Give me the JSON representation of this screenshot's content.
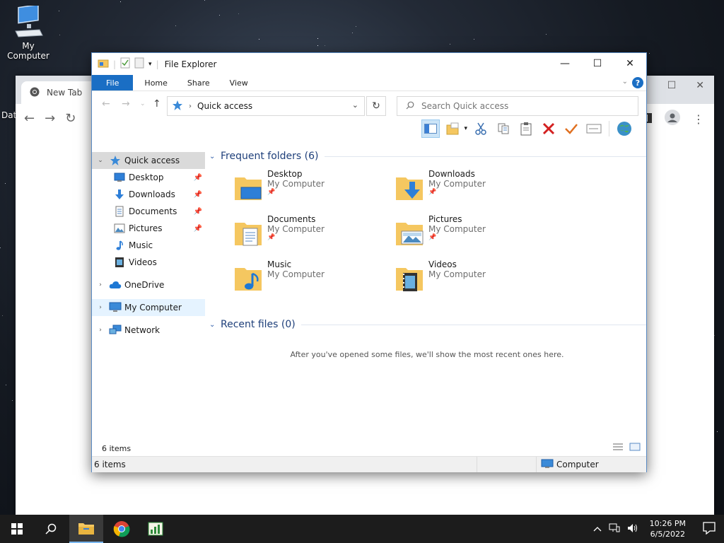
{
  "desktop": {
    "icon_label": "My Computer",
    "partial_label": "Dat"
  },
  "chrome": {
    "tab_title": "New Tab"
  },
  "explorer": {
    "title": "File Explorer",
    "ribbon_tabs": [
      "File",
      "Home",
      "Share",
      "View"
    ],
    "help_label": "?",
    "address": "Quick access",
    "search_placeholder": "Search Quick access",
    "nav": {
      "quick_access": "Quick access",
      "desktop": "Desktop",
      "downloads": "Downloads",
      "documents": "Documents",
      "pictures": "Pictures",
      "music": "Music",
      "videos": "Videos",
      "onedrive": "OneDrive",
      "my_computer": "My Computer",
      "network": "Network"
    },
    "frequent_header": "Frequent folders (6)",
    "folders": [
      {
        "name": "Desktop",
        "location": "My Computer",
        "pinned": true,
        "icon": "folder-desktop-icon"
      },
      {
        "name": "Downloads",
        "location": "My Computer",
        "pinned": true,
        "icon": "folder-downloads-icon"
      },
      {
        "name": "Documents",
        "location": "My Computer",
        "pinned": true,
        "icon": "folder-documents-icon"
      },
      {
        "name": "Pictures",
        "location": "My Computer",
        "pinned": true,
        "icon": "folder-pictures-icon"
      },
      {
        "name": "Music",
        "location": "My Computer",
        "pinned": false,
        "icon": "folder-music-icon"
      },
      {
        "name": "Videos",
        "location": "My Computer",
        "pinned": false,
        "icon": "folder-videos-icon"
      }
    ],
    "recent_header": "Recent files (0)",
    "recent_message": "After you've opened some files, we'll show the most recent ones here.",
    "status_items": "6 items",
    "statusbar_items": "6 items",
    "statusbar_location": "Computer"
  },
  "taskbar": {
    "time": "10:26 PM",
    "date": "6/5/2022"
  },
  "colors": {
    "accent": "#1a6ec4",
    "folder": "#f5c760",
    "section_header": "#1e3f7a"
  }
}
